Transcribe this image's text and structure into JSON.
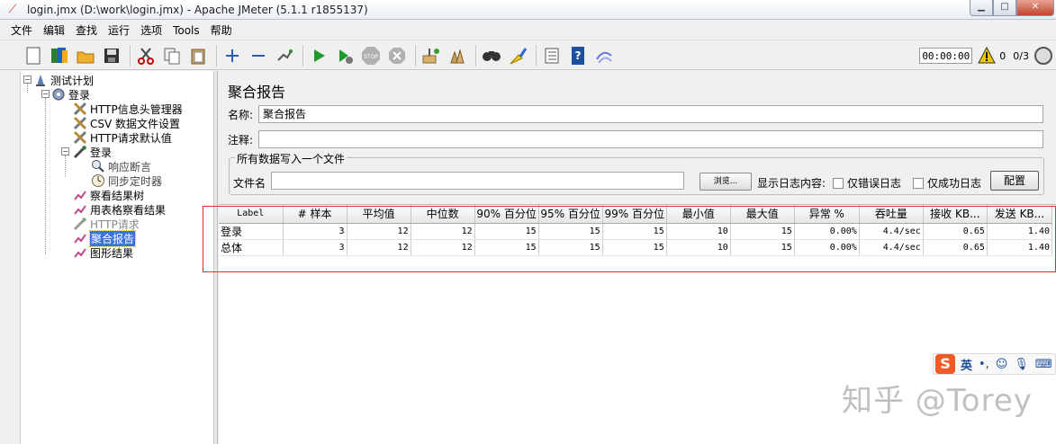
{
  "window": {
    "title": "login.jmx (D:\\work\\login.jmx) - Apache JMeter (5.1.1 r1855137)",
    "controls": {
      "minimize": "▁",
      "maximize": "□",
      "close": "✕"
    }
  },
  "menu": [
    "文件",
    "编辑",
    "查找",
    "运行",
    "选项",
    "Tools",
    "帮助"
  ],
  "toolbar": {
    "buttons": [
      "new-icon",
      "templates-icon",
      "open-icon",
      "save-icon",
      "cut-icon",
      "copy-icon",
      "paste-icon",
      "expand-icon",
      "collapse-icon",
      "toggle-icon",
      "start-icon",
      "start-no-pause-icon",
      "stop-icon",
      "shutdown-icon",
      "clear-icon",
      "clear-all-icon",
      "search-icon",
      "reset-search-icon",
      "function-helper-icon",
      "help-icon",
      "remote-icon"
    ],
    "timer": "00:00:00",
    "warning_count": "0",
    "threads": "0/3"
  },
  "tree": {
    "nodes": [
      {
        "label": "测试计划",
        "icon": "test-plan-icon"
      },
      {
        "label": "登录",
        "icon": "thread-group-icon"
      },
      {
        "label": "HTTP信息头管理器",
        "icon": "config-icon"
      },
      {
        "label": "CSV 数据文件设置",
        "icon": "config-icon"
      },
      {
        "label": "HTTP请求默认值",
        "icon": "config-icon"
      },
      {
        "label": "登录",
        "icon": "sampler-icon"
      },
      {
        "label": "响应断言",
        "icon": "assertion-icon"
      },
      {
        "label": "同步定时器",
        "icon": "timer-icon"
      },
      {
        "label": "察看结果树",
        "icon": "listener-icon"
      },
      {
        "label": "用表格察看结果",
        "icon": "listener-icon"
      },
      {
        "label": "HTTP请求",
        "icon": "sampler-icon"
      },
      {
        "label": "聚合报告",
        "icon": "listener-icon"
      },
      {
        "label": "图形结果",
        "icon": "listener-icon"
      }
    ]
  },
  "panel": {
    "title": "聚合报告",
    "name_label": "名称:",
    "name_value": "聚合报告",
    "comment_label": "注释:",
    "comment_value": "",
    "file_group_legend": "所有数据写入一个文件",
    "filename_label": "文件名",
    "filename_value": "",
    "browse_label": "浏览...",
    "log_content_label": "显示日志内容:",
    "errors_only_label": "仅错误日志",
    "success_only_label": "仅成功日志",
    "configure_label": "配置"
  },
  "table": {
    "headers": [
      "Label",
      "# 样本",
      "平均值",
      "中位数",
      "90% 百分位",
      "95% 百分位",
      "99% 百分位",
      "最小值",
      "最大值",
      "异常 %",
      "吞吐量",
      "接收 KB...",
      "发送 KB..."
    ],
    "rows": [
      [
        "登录",
        "3",
        "12",
        "12",
        "15",
        "15",
        "15",
        "10",
        "15",
        "0.00%",
        "4.4/sec",
        "0.65",
        "1.40"
      ],
      [
        "总体",
        "3",
        "12",
        "12",
        "15",
        "15",
        "15",
        "10",
        "15",
        "0.00%",
        "4.4/sec",
        "0.65",
        "1.40"
      ]
    ]
  },
  "ime": {
    "lang": "英",
    "punct": "•,",
    "icons": [
      "smile-icon",
      "mic-icon",
      "keyboard-icon"
    ]
  },
  "watermark": "知乎 @Torey"
}
